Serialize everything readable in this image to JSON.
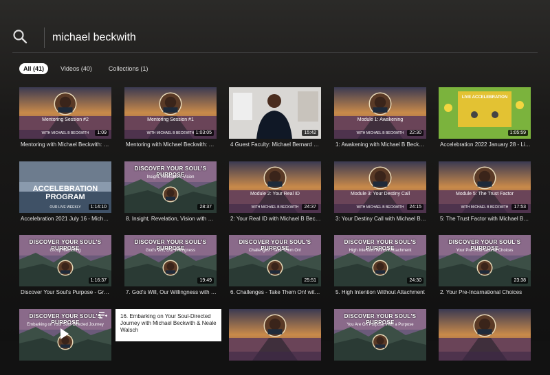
{
  "search": {
    "query": "michael beckwith",
    "placeholder": "Search"
  },
  "tabs": [
    {
      "label": "All (41)",
      "active": true
    },
    {
      "label": "Videos (40)",
      "active": false
    },
    {
      "label": "Collections (1)",
      "active": false
    }
  ],
  "cards": [
    {
      "title": "Mentoring with Michael Beckwith: Session #2",
      "duration": "1:09",
      "overlay": "Mentoring Session #2",
      "sub": "WITH MICHAEL B BECKWITH",
      "style": "road"
    },
    {
      "title": "Mentoring with Michael Beckwith: Session #1",
      "duration": "1:03:05",
      "overlay": "Mentoring Session #1",
      "sub": "WITH MICHAEL B BECKWITH",
      "style": "road"
    },
    {
      "title": "4 Guest Faculty: Michael Bernard Beckwith",
      "duration": "15:42",
      "overlay": "",
      "sub": "",
      "style": "video"
    },
    {
      "title": "1: Awakening with Michael B Beckwith",
      "duration": "22:30",
      "overlay": "Module 1: Awakening",
      "sub": "WITH MICHAEL B BECKWITH",
      "style": "road"
    },
    {
      "title": "Accelebration 2022 January 28 - Live",
      "duration": "1:05:59",
      "overlay": "LIVE ACCELEBRATION",
      "sub": "",
      "style": "green"
    },
    {
      "title": "Accelebration 2021 July 16 - Michael Beckwith",
      "duration": "1:14:10",
      "overlay": "ACCELEBRATION PROGRAM",
      "sub": "OUR LIVE WEEKLY",
      "style": "sea"
    },
    {
      "title": "8. Insight, Revelation, Vision with Michael Beckwith",
      "duration": "28:37",
      "overlay": "Insight, Revelation, Vision",
      "sub": "DISCOVER YOUR SOUL'S PURPOSE",
      "style": "mountain"
    },
    {
      "title": "2: Your Real ID with Michael B Beckwith",
      "duration": "24:37",
      "overlay": "Module 2: Your Real ID",
      "sub": "WITH MICHAEL B BECKWITH",
      "style": "road"
    },
    {
      "title": "3: Your Destiny Call with Michael Beckwith",
      "duration": "24:15",
      "overlay": "Module 3: Your Destiny Call",
      "sub": "WITH MICHAEL B BECKWITH",
      "style": "road"
    },
    {
      "title": "5: The Trust Factor with Michael Beckwith",
      "duration": "17:53",
      "overlay": "Module 5: The Trust Factor",
      "sub": "WITH MICHAEL B BECKWITH",
      "style": "road"
    },
    {
      "title": "Discover Your Soul's Purpose - Group Mentoring",
      "duration": "1:16:37",
      "overlay": "Group Mentoring",
      "sub": "DISCOVER YOUR SOUL'S PURPOSE",
      "style": "mountain"
    },
    {
      "title": "7. God's Will, Our Willingness with Michael Beckwith",
      "duration": "19:49",
      "overlay": "God's Will, Our Willingness",
      "sub": "DISCOVER YOUR SOUL'S PURPOSE",
      "style": "mountain"
    },
    {
      "title": "6. Challenges - Take Them On! with Michael Beckwith",
      "duration": "25:51",
      "overlay": "Challenges - Take Them On!",
      "sub": "DISCOVER YOUR SOUL'S PURPOSE",
      "style": "mountain"
    },
    {
      "title": "5. High Intention Without Attachment",
      "duration": "24:30",
      "overlay": "High Intention Without Attachment",
      "sub": "DISCOVER YOUR SOUL'S PURPOSE",
      "style": "mountain"
    },
    {
      "title": "2. Your Pre-Incarnational Choices",
      "duration": "23:38",
      "overlay": "Your Pre-Incarnational Choices",
      "sub": "DISCOVER YOUR SOUL'S PURPOSE",
      "style": "mountain"
    },
    {
      "title": "",
      "duration": "",
      "overlay": "Embarking on Your Soul-Directed Journey",
      "sub": "DISCOVER YOUR SOUL'S PURPOSE",
      "style": "mountain"
    },
    {
      "title": "",
      "duration": "",
      "overlay": "",
      "sub": "",
      "style": "hidden"
    },
    {
      "title": "",
      "duration": "",
      "overlay": "",
      "sub": "",
      "style": "road"
    },
    {
      "title": "",
      "duration": "",
      "overlay": "You Are On Purpose With a Purpose",
      "sub": "DISCOVER YOUR SOUL'S PURPOSE",
      "style": "mountain"
    },
    {
      "title": "",
      "duration": "",
      "overlay": "",
      "sub": "",
      "style": "road"
    }
  ],
  "tooltip": {
    "text": "16. Embarking on Your Soul-Directed Journey with Michael Beckwith & Neale Walsch"
  },
  "colors": {
    "accent": "#ffffff",
    "background": "#121212"
  }
}
